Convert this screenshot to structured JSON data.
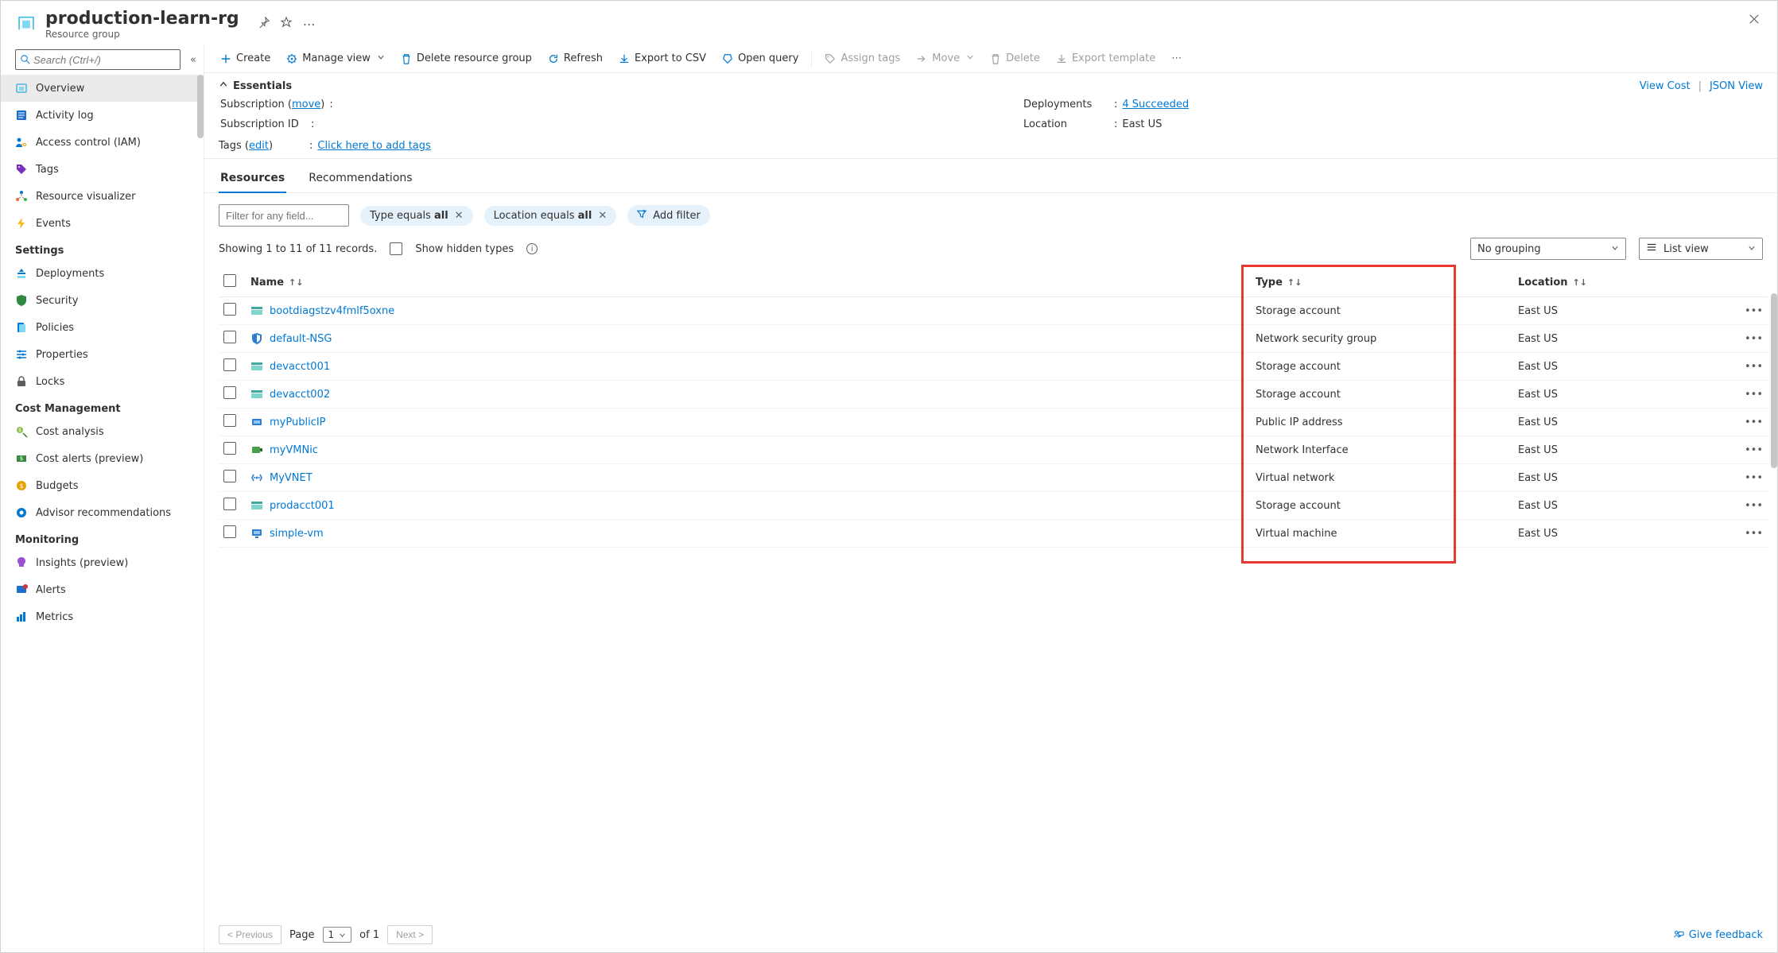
{
  "header": {
    "title": "production-learn-rg",
    "subtitle": "Resource group"
  },
  "sidebar": {
    "search_placeholder": "Search (Ctrl+/)",
    "items": [
      {
        "label": "Overview",
        "icon": "overview",
        "active": true
      },
      {
        "label": "Activity log",
        "icon": "activity"
      },
      {
        "label": "Access control (IAM)",
        "icon": "iam"
      },
      {
        "label": "Tags",
        "icon": "tags"
      },
      {
        "label": "Resource visualizer",
        "icon": "visualizer"
      },
      {
        "label": "Events",
        "icon": "events"
      }
    ],
    "settings_header": "Settings",
    "settings": [
      {
        "label": "Deployments",
        "icon": "deployments"
      },
      {
        "label": "Security",
        "icon": "security"
      },
      {
        "label": "Policies",
        "icon": "policies"
      },
      {
        "label": "Properties",
        "icon": "properties"
      },
      {
        "label": "Locks",
        "icon": "locks"
      }
    ],
    "cost_header": "Cost Management",
    "cost": [
      {
        "label": "Cost analysis",
        "icon": "costanalysis"
      },
      {
        "label": "Cost alerts (preview)",
        "icon": "costalerts"
      },
      {
        "label": "Budgets",
        "icon": "budgets"
      },
      {
        "label": "Advisor recommendations",
        "icon": "advisor"
      }
    ],
    "monitoring_header": "Monitoring",
    "monitoring": [
      {
        "label": "Insights (preview)",
        "icon": "insights"
      },
      {
        "label": "Alerts",
        "icon": "alerts"
      },
      {
        "label": "Metrics",
        "icon": "metrics"
      }
    ]
  },
  "commands": {
    "create": "Create",
    "manage_view": "Manage view",
    "delete_rg": "Delete resource group",
    "refresh": "Refresh",
    "export_csv": "Export to CSV",
    "open_query": "Open query",
    "assign_tags": "Assign tags",
    "move": "Move",
    "delete": "Delete",
    "export_template": "Export template"
  },
  "essentials": {
    "header": "Essentials",
    "view_cost": "View Cost",
    "json_view": "JSON View",
    "subscription_key": "Subscription (",
    "move_link": "move",
    "subscription_key_end": ")",
    "subscription_id_key": "Subscription ID",
    "deployments_key": "Deployments",
    "deployments_val": "4 Succeeded",
    "location_key": "Location",
    "location_val": "East US",
    "tags_key": "Tags (",
    "edit_link": "edit",
    "tags_key_end": ")",
    "tags_val": "Click here to add tags"
  },
  "tabs": {
    "resources": "Resources",
    "recommendations": "Recommendations"
  },
  "filters": {
    "filter_placeholder": "Filter for any field...",
    "type_equals": "Type equals ",
    "type_val": "all",
    "location_equals": "Location equals ",
    "location_val": "all",
    "add_filter": "Add filter"
  },
  "meta": {
    "records": "Showing 1 to 11 of 11 records.",
    "show_hidden": "Show hidden types",
    "no_grouping": "No grouping",
    "list_view": "List view"
  },
  "columns": {
    "name": "Name",
    "type": "Type",
    "location": "Location"
  },
  "rows": [
    {
      "name": "bootdiagstzv4fmlf5oxne",
      "type": "Storage account",
      "location": "East US",
      "icon": "storage"
    },
    {
      "name": "default-NSG",
      "type": "Network security group",
      "location": "East US",
      "icon": "nsg"
    },
    {
      "name": "devacct001",
      "type": "Storage account",
      "location": "East US",
      "icon": "storage"
    },
    {
      "name": "devacct002",
      "type": "Storage account",
      "location": "East US",
      "icon": "storage"
    },
    {
      "name": "myPublicIP",
      "type": "Public IP address",
      "location": "East US",
      "icon": "pip"
    },
    {
      "name": "myVMNic",
      "type": "Network Interface",
      "location": "East US",
      "icon": "nic"
    },
    {
      "name": "MyVNET",
      "type": "Virtual network",
      "location": "East US",
      "icon": "vnet"
    },
    {
      "name": "prodacct001",
      "type": "Storage account",
      "location": "East US",
      "icon": "storage"
    },
    {
      "name": "simple-vm",
      "type": "Virtual machine",
      "location": "East US",
      "icon": "vm"
    }
  ],
  "pager": {
    "previous": "< Previous",
    "page_label": "Page",
    "page_number": "1",
    "of": "of 1",
    "next": "Next >",
    "feedback": "Give feedback"
  }
}
